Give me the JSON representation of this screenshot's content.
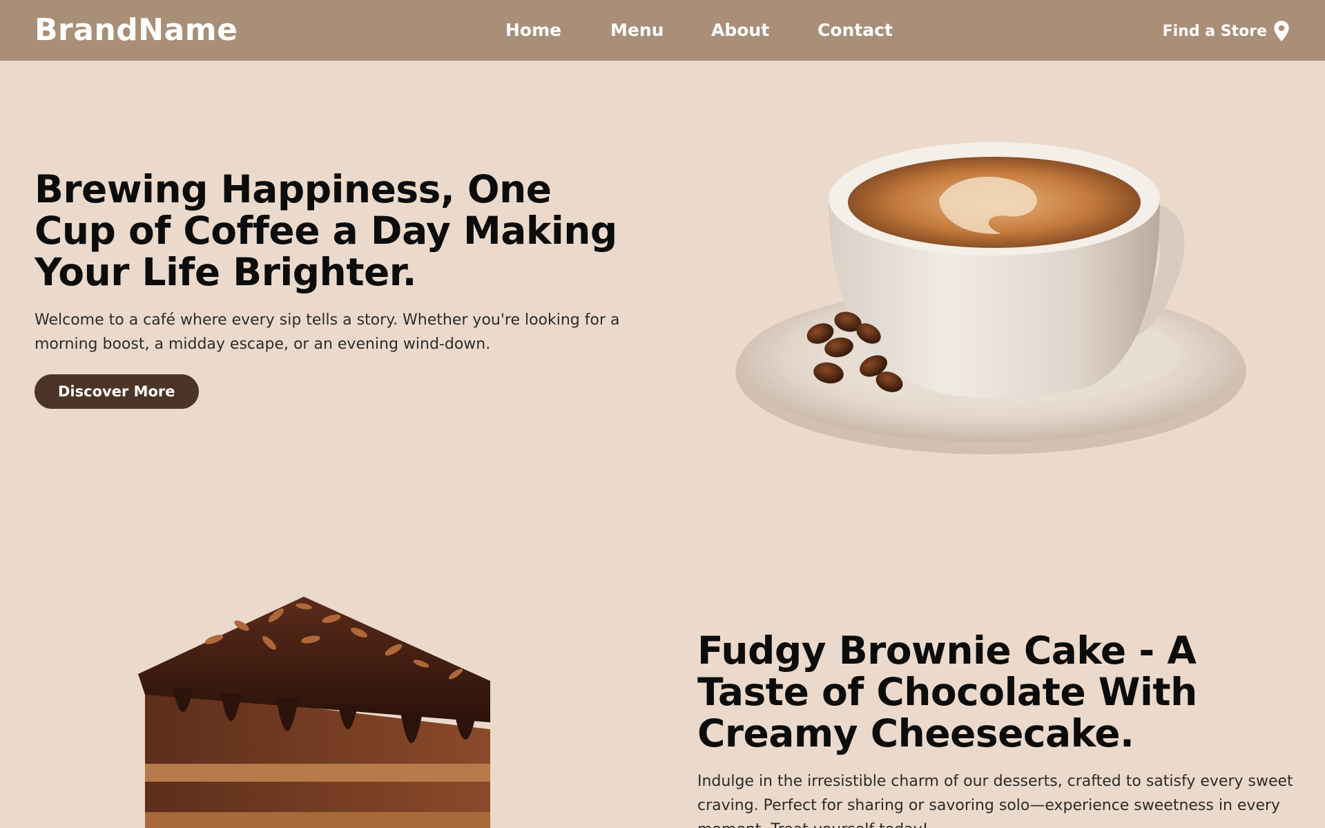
{
  "nav": {
    "brand": "BrandName",
    "links": [
      {
        "label": "Home"
      },
      {
        "label": "Menu"
      },
      {
        "label": "About"
      },
      {
        "label": "Contact"
      }
    ],
    "find_store": "Find a Store",
    "icon": "map-pin-icon"
  },
  "hero": {
    "title": "Brewing Happiness, One Cup of Coffee a Day Making Your Life Brighter.",
    "body": "Welcome to a café where every sip tells a story. Whether you're looking for a morning boost, a midday escape, or an evening wind-down.",
    "cta": "Discover More"
  },
  "feature": {
    "title": "Fudgy Brownie Cake - A Taste of Chocolate With Creamy Cheesecake.",
    "body": "Indulge in the irresistible charm of our desserts, crafted to satisfy every sweet craving. Perfect for sharing or savoring solo—experience sweetness in every moment. Treat yourself today!"
  },
  "colors": {
    "nav_bg": "#a98f78",
    "page_bg": "#ebdacb",
    "button_bg": "#4b3427"
  }
}
